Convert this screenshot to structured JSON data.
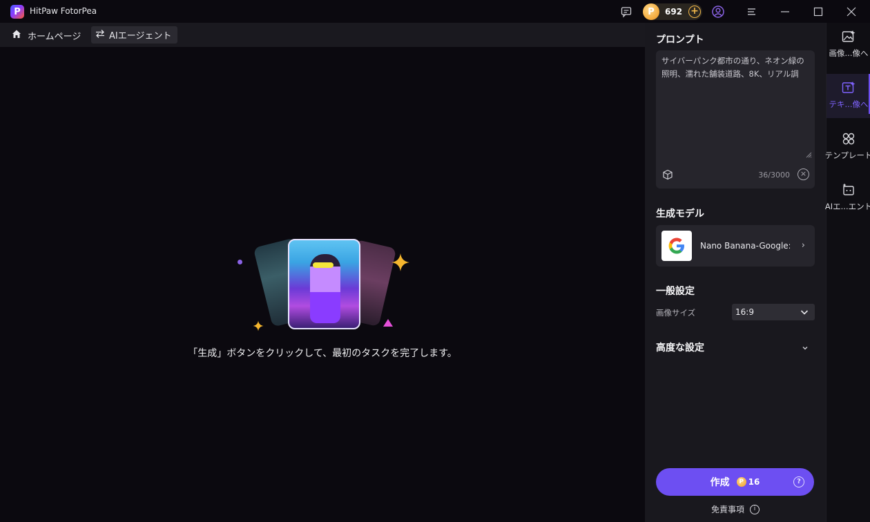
{
  "app": {
    "title": "HitPaw FotorPea",
    "logo_letter": "P",
    "credits": "692"
  },
  "nav": {
    "home_label": "ホームページ",
    "agent_label": "AIエージェント"
  },
  "canvas": {
    "empty_message": "「生成」ボタンをクリックして、最初のタスクを完了します。"
  },
  "panel": {
    "prompt_title": "プロンプト",
    "prompt_text": "サイバーパンク都市の通り、ネオン緑の照明、濡れた舗装道路、8K、リアル調",
    "prompt_count": "36/3000",
    "model_title": "生成モデル",
    "model_name": "Nano Banana-Google:...",
    "general_title": "一般設定",
    "image_size_label": "画像サイズ",
    "image_size_value": "16:9",
    "advanced_title": "高度な設定",
    "generate_label": "作成",
    "generate_cost": "16",
    "disclaimer": "免責事項"
  },
  "rail": {
    "items": [
      {
        "label": "画像...像へ",
        "icon": "image-to-image-icon",
        "active": false
      },
      {
        "label": "テキ...像へ",
        "icon": "text-to-image-icon",
        "active": true
      },
      {
        "label": "テンプレート",
        "icon": "template-icon",
        "active": false
      },
      {
        "label": "AIエ...エント",
        "icon": "ai-agent-icon",
        "active": false
      }
    ]
  },
  "colors": {
    "accent": "#6d4ff2",
    "coin": "#f3a93a"
  }
}
